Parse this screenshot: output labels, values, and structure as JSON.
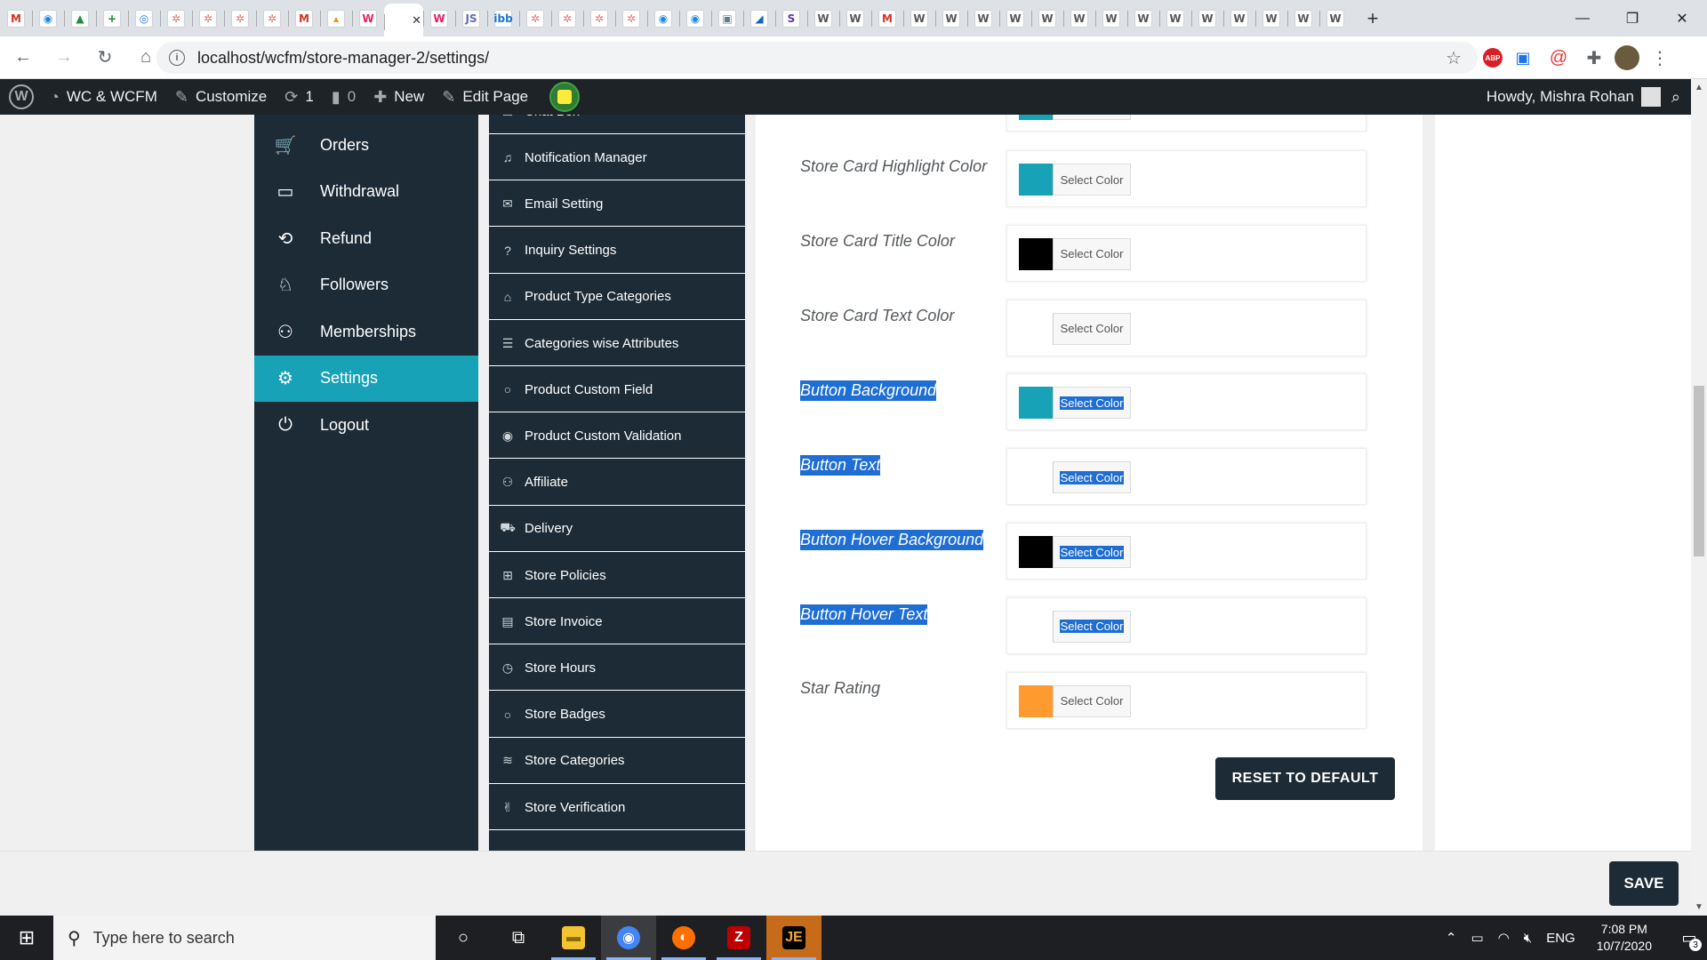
{
  "browser": {
    "tabs": [
      {
        "icon": "gmail-icon",
        "glyph": "M",
        "color": "#d93025"
      },
      {
        "icon": "chrome-web-icon",
        "glyph": "◉",
        "color": "#1e88e5"
      },
      {
        "icon": "drive-icon",
        "glyph": "▲",
        "color": "#1e8e3e"
      },
      {
        "icon": "sheets-plus-icon",
        "glyph": "+",
        "color": "#188038"
      },
      {
        "icon": "inbox-icon",
        "glyph": "◎",
        "color": "#1a73e8"
      },
      {
        "icon": "lotus-icon",
        "glyph": "✲",
        "color": "#e57373"
      },
      {
        "icon": "lotus-icon",
        "glyph": "✲",
        "color": "#e57373"
      },
      {
        "icon": "lotus-icon",
        "glyph": "✲",
        "color": "#e57373"
      },
      {
        "icon": "lotus-icon",
        "glyph": "✲",
        "color": "#e57373"
      },
      {
        "icon": "gmail-icon",
        "glyph": "M",
        "color": "#d93025"
      },
      {
        "icon": "phpmyadmin-icon",
        "glyph": "▴",
        "color": "#f29111"
      },
      {
        "icon": "woo-icon",
        "glyph": "W",
        "color": "#e91e63"
      },
      {
        "icon": "active-tab-favicon",
        "glyph": "",
        "color": "#ffffff",
        "active": true
      },
      {
        "icon": "woo-icon",
        "glyph": "W",
        "color": "#e91e63"
      },
      {
        "icon": "js-icon",
        "glyph": "JS",
        "color": "#5c6bc0"
      },
      {
        "icon": "ibb-icon",
        "glyph": "ibb",
        "color": "#1976d2"
      },
      {
        "icon": "lotus-icon",
        "glyph": "✲",
        "color": "#e57373"
      },
      {
        "icon": "lotus-icon",
        "glyph": "✲",
        "color": "#e57373"
      },
      {
        "icon": "lotus-icon",
        "glyph": "✲",
        "color": "#e57373"
      },
      {
        "icon": "lotus-icon",
        "glyph": "✲",
        "color": "#e57373"
      },
      {
        "icon": "globe-icon",
        "glyph": "◉",
        "color": "#1e88e5"
      },
      {
        "icon": "globe-icon",
        "glyph": "◉",
        "color": "#1e88e5"
      },
      {
        "icon": "screen-icon",
        "glyph": "▣",
        "color": "#607d8b"
      },
      {
        "icon": "feather-icon",
        "glyph": "◢",
        "color": "#1565c0"
      },
      {
        "icon": "s-icon",
        "glyph": "S",
        "color": "#5e35b1"
      },
      {
        "icon": "wordpress-icon",
        "glyph": "W",
        "color": "#555555"
      },
      {
        "icon": "wordpress-icon",
        "glyph": "W",
        "color": "#555555"
      },
      {
        "icon": "gmail-icon",
        "glyph": "M",
        "color": "#d93025"
      },
      {
        "icon": "wordpress-icon",
        "glyph": "W",
        "color": "#555555"
      },
      {
        "icon": "wordpress-icon",
        "glyph": "W",
        "color": "#555555"
      },
      {
        "icon": "wordpress-icon",
        "glyph": "W",
        "color": "#555555"
      },
      {
        "icon": "wordpress-icon",
        "glyph": "W",
        "color": "#555555"
      },
      {
        "icon": "wordpress-icon",
        "glyph": "W",
        "color": "#555555"
      },
      {
        "icon": "wordpress-icon",
        "glyph": "W",
        "color": "#555555"
      },
      {
        "icon": "wordpress-icon",
        "glyph": "W",
        "color": "#555555"
      },
      {
        "icon": "wordpress-icon",
        "glyph": "W",
        "color": "#555555"
      },
      {
        "icon": "wordpress-icon",
        "glyph": "W",
        "color": "#555555"
      },
      {
        "icon": "wordpress-icon",
        "glyph": "W",
        "color": "#555555"
      },
      {
        "icon": "wordpress-icon",
        "glyph": "W",
        "color": "#555555"
      },
      {
        "icon": "wordpress-icon",
        "glyph": "W",
        "color": "#555555"
      },
      {
        "icon": "wordpress-icon",
        "glyph": "W",
        "color": "#555555"
      },
      {
        "icon": "wordpress-icon",
        "glyph": "W",
        "color": "#555555"
      }
    ],
    "new_tab_glyph": "+",
    "url": "localhost/wcfm/store-manager-2/settings/",
    "ext_abp": "ABP"
  },
  "admin_bar": {
    "site_name": "WC & WCFM",
    "customize": "Customize",
    "updates_count": "1",
    "comments_count": "0",
    "new": "New",
    "edit_page": "Edit Page",
    "howdy": "Howdy, Mishra Rohan"
  },
  "sidebar": {
    "items": [
      {
        "label": "Orders",
        "icon": "cart-icon",
        "glyph": "🛒"
      },
      {
        "label": "Withdrawal",
        "icon": "credit-card-icon",
        "glyph": "▭"
      },
      {
        "label": "Refund",
        "icon": "refund-icon",
        "glyph": "⟲"
      },
      {
        "label": "Followers",
        "icon": "followers-icon",
        "glyph": "♘"
      },
      {
        "label": "Memberships",
        "icon": "add-user-icon",
        "glyph": "⚇"
      },
      {
        "label": "Settings",
        "icon": "settings-gears-icon",
        "glyph": "⚙",
        "active": true
      },
      {
        "label": "Logout",
        "icon": "power-icon",
        "glyph": "⏻"
      }
    ]
  },
  "settings_tabs": {
    "items": [
      {
        "label": "Chat Box",
        "icon": "chat-icon",
        "glyph": "☐"
      },
      {
        "label": "Notification Manager",
        "icon": "bell-icon",
        "glyph": "♫"
      },
      {
        "label": "Email Setting",
        "icon": "envelope-icon",
        "glyph": "✉"
      },
      {
        "label": "Inquiry Settings",
        "icon": "question-icon",
        "glyph": "?"
      },
      {
        "label": "Product Type Categories",
        "icon": "tags-icon",
        "glyph": "⌂"
      },
      {
        "label": "Categories wise Attributes",
        "icon": "list-icon",
        "glyph": "☰"
      },
      {
        "label": "Product Custom Field",
        "icon": "comment-icon",
        "glyph": "○"
      },
      {
        "label": "Product Custom Validation",
        "icon": "validation-icon",
        "glyph": "◉"
      },
      {
        "label": "Affiliate",
        "icon": "users-icon",
        "glyph": "⚇"
      },
      {
        "label": "Delivery",
        "icon": "truck-icon",
        "glyph": "⛟"
      },
      {
        "label": "Store Policies",
        "icon": "ambulance-icon",
        "glyph": "⊞"
      },
      {
        "label": "Store Invoice",
        "icon": "invoice-icon",
        "glyph": "▤"
      },
      {
        "label": "Store Hours",
        "icon": "clock-icon",
        "glyph": "◷"
      },
      {
        "label": "Store Badges",
        "icon": "badge-icon",
        "glyph": "○"
      },
      {
        "label": "Store Categories",
        "icon": "layers-icon",
        "glyph": "≋"
      },
      {
        "label": "Store Verification",
        "icon": "verification-icon",
        "glyph": "✌"
      },
      {
        "label": "",
        "icon": "more-icon",
        "glyph": "…"
      }
    ]
  },
  "color_settings": {
    "rows": [
      {
        "label": "",
        "color": "#17a2b8",
        "button": "Select Color",
        "selected": false
      },
      {
        "label": "Store Card Highlight Color",
        "color": "#17a2b8",
        "button": "Select Color",
        "selected": false
      },
      {
        "label": "Store Card Title Color",
        "color": "#000000",
        "button": "Select Color",
        "selected": false
      },
      {
        "label": "Store Card Text Color",
        "color": "#ffffff",
        "button": "Select Color",
        "selected": false
      },
      {
        "label": "Button Background",
        "color": "#17a2b8",
        "button": "Select Color",
        "selected": true
      },
      {
        "label": "Button Text",
        "color": "#ffffff",
        "button": "Select Color",
        "selected": true
      },
      {
        "label": "Button Hover Background",
        "color": "#000000",
        "button": "Select Color",
        "selected": true
      },
      {
        "label": "Button Hover Text",
        "color": "#ffffff",
        "button": "Select Color",
        "selected": true
      },
      {
        "label": "Star Rating",
        "color": "#ff9a2e",
        "button": "Select Color",
        "selected": false
      }
    ],
    "reset_label": "RESET TO DEFAULT"
  },
  "save_label": "SAVE",
  "taskbar": {
    "search_placeholder": "Type here to search",
    "lang": "ENG",
    "time": "7:08 PM",
    "date": "10/7/2020",
    "notification_count": "3"
  },
  "colors": {
    "sidebar_bg": "#1c2b36",
    "active_accent": "#17a2b8",
    "selection_blue": "#1f6ed4"
  }
}
